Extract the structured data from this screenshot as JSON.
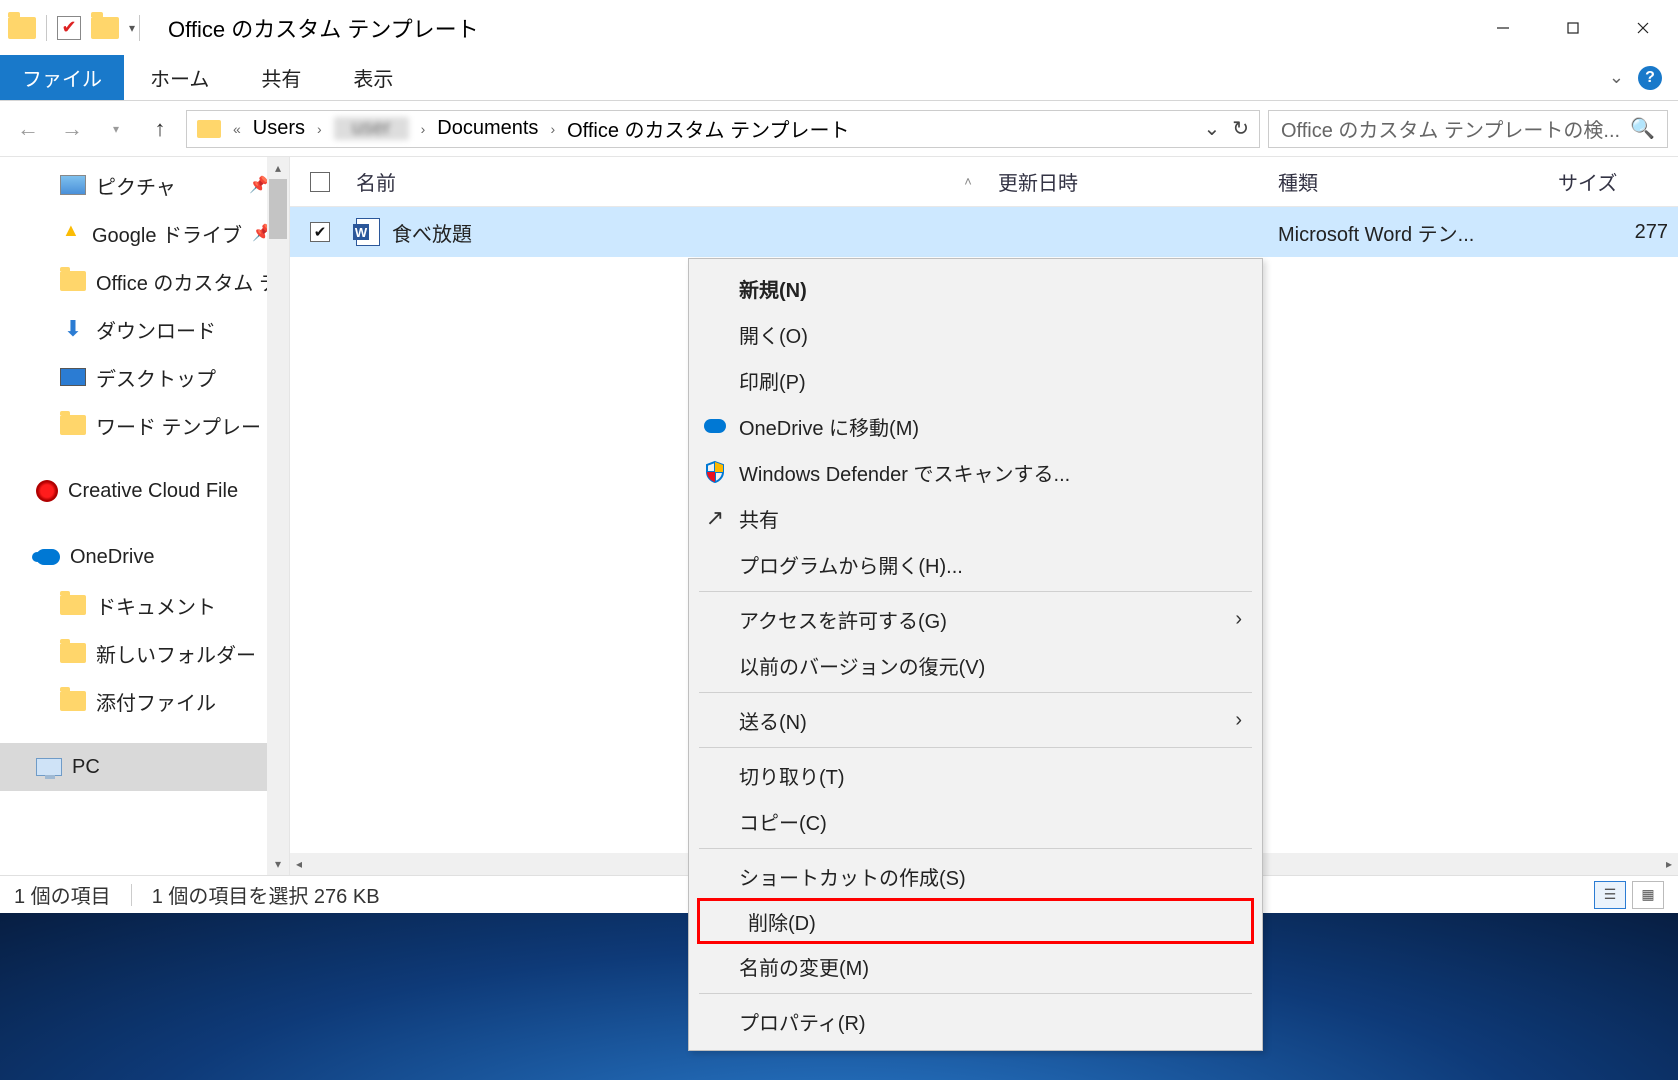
{
  "title": "Office のカスタム テンプレート",
  "ribbon": {
    "file": "ファイル",
    "home": "ホーム",
    "share": "共有",
    "view": "表示"
  },
  "breadcrumb": {
    "users": "Users",
    "documents": "Documents",
    "current": "Office のカスタム テンプレート",
    "leading": "«"
  },
  "search_placeholder": "Office のカスタム テンプレートの検...",
  "columns": {
    "name": "名前",
    "date": "更新日時",
    "type": "種類",
    "size": "サイズ"
  },
  "sidebar": {
    "pictures": "ピクチャ",
    "gdrive": "Google ドライブ",
    "office": "Office のカスタム テ",
    "downloads": "ダウンロード",
    "desktop": "デスクトップ",
    "word_tpl": "ワード テンプレート",
    "cc": "Creative Cloud File",
    "onedrive": "OneDrive",
    "od_docs": "ドキュメント",
    "od_newf": "新しいフォルダー",
    "od_attach": "添付ファイル",
    "pc": "PC"
  },
  "file": {
    "name": "食べ放題",
    "type": "Microsoft Word テン...",
    "size": "277"
  },
  "context": {
    "new": "新規(N)",
    "open": "開く(O)",
    "print": "印刷(P)",
    "move_od": "OneDrive に移動(M)",
    "defender": "Windows Defender でスキャンする...",
    "share": "共有",
    "open_with": "プログラムから開く(H)...",
    "grant_access": "アクセスを許可する(G)",
    "restore_prev": "以前のバージョンの復元(V)",
    "send_to": "送る(N)",
    "cut": "切り取り(T)",
    "copy": "コピー(C)",
    "shortcut": "ショートカットの作成(S)",
    "delete": "削除(D)",
    "rename": "名前の変更(M)",
    "properties": "プロパティ(R)"
  },
  "status": {
    "count": "1 個の項目",
    "selected": "1 個の項目を選択 276 KB"
  }
}
